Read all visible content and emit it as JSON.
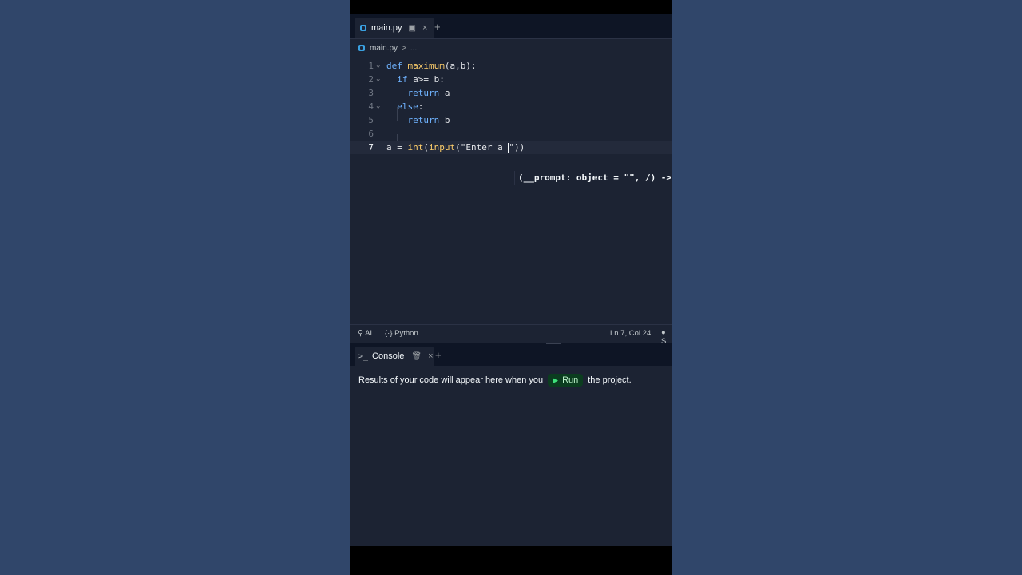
{
  "editor_tab": {
    "label": "main.py",
    "close": "×",
    "add": "+"
  },
  "breadcrumb": {
    "file": "main.py",
    "separator": ">",
    "more": "..."
  },
  "code_lines": [
    {
      "num": "1",
      "text": "def maximum(a,b):"
    },
    {
      "num": "2",
      "text": "if a>= b:"
    },
    {
      "num": "3",
      "text": "return a"
    },
    {
      "num": "4",
      "text": "else:"
    },
    {
      "num": "5",
      "text": "return b"
    },
    {
      "num": "6",
      "text": ""
    },
    {
      "num": "7",
      "text": "a = int(input(\"Enter a \"))"
    }
  ],
  "signature_hint": "(__prompt: object = \"\", /) ->",
  "statusbar": {
    "ai": "AI",
    "language": "Python",
    "cursor_position": "Ln 7, Col 24",
    "extra": "S"
  },
  "console_tab": {
    "label": "Console",
    "close": "×",
    "add": "+"
  },
  "console": {
    "message_before": "Results of your code will appear here when you",
    "run_label": "Run",
    "message_after": "the project."
  },
  "colors": {
    "keyword": "#6fb3ff",
    "function": "#ffcf6b",
    "run_accent": "#3ee07a"
  }
}
